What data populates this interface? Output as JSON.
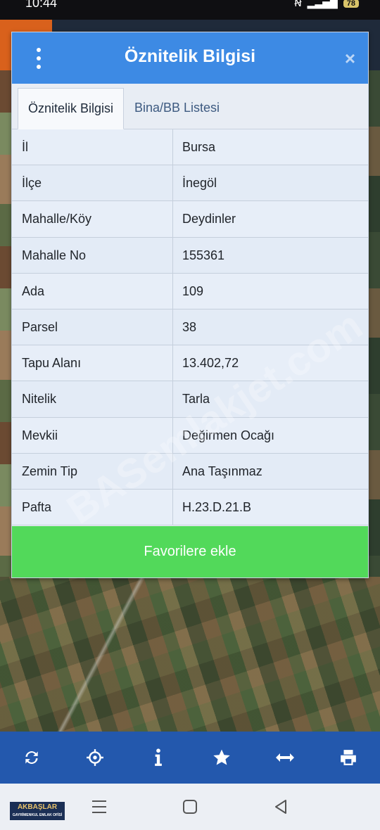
{
  "status_bar": {
    "time": "10:44",
    "battery": "78"
  },
  "dialog": {
    "title": "Öznitelik Bilgisi",
    "close": "×",
    "tabs": [
      {
        "label": "Öznitelik Bilgisi",
        "active": true
      },
      {
        "label": "Bina/BB Listesi",
        "active": false
      }
    ],
    "rows": [
      {
        "key": "İl",
        "value": "Bursa"
      },
      {
        "key": "İlçe",
        "value": "İnegöl"
      },
      {
        "key": "Mahalle/Köy",
        "value": "Deydinler"
      },
      {
        "key": "Mahalle No",
        "value": "155361"
      },
      {
        "key": "Ada",
        "value": "109"
      },
      {
        "key": "Parsel",
        "value": "38"
      },
      {
        "key": "Tapu Alanı",
        "value": "13.402,72"
      },
      {
        "key": "Nitelik",
        "value": "Tarla"
      },
      {
        "key": "Mevkii",
        "value": "Değirmen Ocağı"
      },
      {
        "key": "Zemin Tip",
        "value": "Ana Taşınmaz"
      },
      {
        "key": "Pafta",
        "value": "H.23.D.21.B"
      }
    ],
    "favorite_button": "Favorilere ekle"
  },
  "watermark": "BASemlakjet.com",
  "toolbar": {
    "icons": [
      "refresh-icon",
      "crosshair-icon",
      "info-icon",
      "star-icon",
      "measure-icon",
      "print-icon"
    ]
  },
  "logo": {
    "name": "AKBAŞLAR",
    "tagline": "GAYRİMENKUL EMLAK OFİSİ"
  },
  "colors": {
    "header": "#3d8ae4",
    "favorite_button": "#52d95a",
    "toolbar": "#2358ad"
  }
}
